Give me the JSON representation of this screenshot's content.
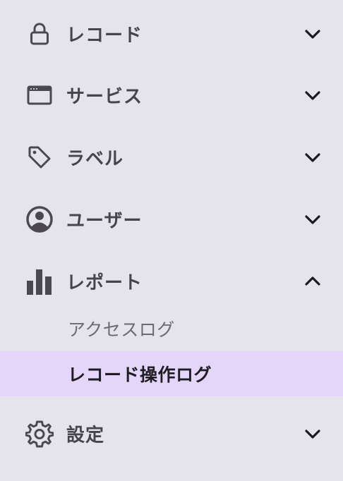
{
  "menu": {
    "items": [
      {
        "label": "レコード",
        "icon": "lock-icon",
        "expanded": false
      },
      {
        "label": "サービス",
        "icon": "browser-window-icon",
        "expanded": false
      },
      {
        "label": "ラベル",
        "icon": "tag-icon",
        "expanded": false
      },
      {
        "label": "ユーザー",
        "icon": "user-circle-icon",
        "expanded": false
      },
      {
        "label": "レポート",
        "icon": "bar-chart-icon",
        "expanded": true,
        "children": [
          {
            "label": "アクセスログ",
            "active": false
          },
          {
            "label": "レコード操作ログ",
            "active": true
          }
        ]
      },
      {
        "label": "設定",
        "icon": "gear-icon",
        "expanded": false
      }
    ]
  },
  "colors": {
    "background": "#e5e4ec",
    "active_background": "#e3d6f8",
    "icon": "#4b4852",
    "text": "#46444d"
  }
}
